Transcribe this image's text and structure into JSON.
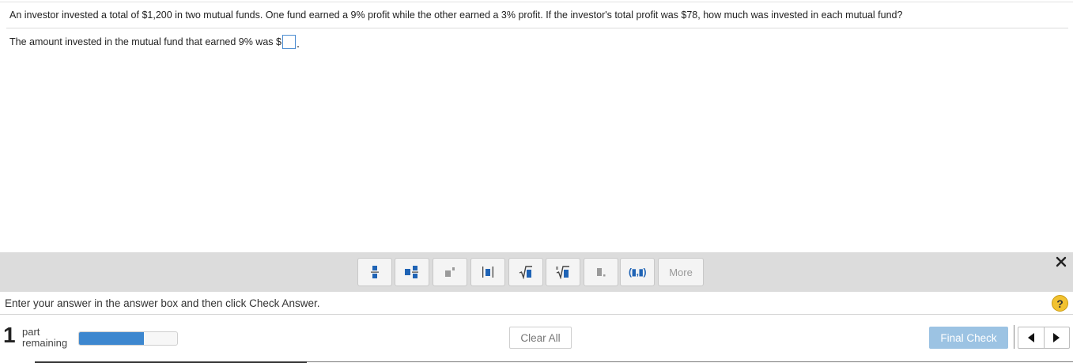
{
  "question": {
    "text": "An investor invested a total of $1,200 in two mutual funds. One fund earned a 9% profit while the other earned a 3% profit. If the investor's total profit was $78, how much was invested in each mutual fund?",
    "answer_prompt": "The amount invested in the mutual fund that earned 9% was $",
    "answer_value": ""
  },
  "toolbar": {
    "buttons": [
      {
        "icon": "fraction-icon"
      },
      {
        "icon": "mixed-number-icon"
      },
      {
        "icon": "exponent-icon"
      },
      {
        "icon": "absolute-value-icon"
      },
      {
        "icon": "square-root-icon"
      },
      {
        "icon": "nth-root-icon"
      },
      {
        "icon": "decimal-icon"
      },
      {
        "icon": "ordered-pair-icon"
      }
    ],
    "ordered_pair_label": "(▮,▮)",
    "more_label": "More"
  },
  "instructions": {
    "text": "Enter your answer in the answer box and then click Check Answer.",
    "help_label": "?"
  },
  "footer": {
    "parts_count": "1",
    "parts_label_1": "part",
    "parts_label_2": "remaining",
    "progress": 0.66,
    "clear_all_label": "Clear All",
    "final_check_label": "Final Check"
  },
  "colors": {
    "accent": "#3d87cf",
    "final_check_bg": "#9cc3e3",
    "toolbar_bg": "#dcdcdc",
    "help_icon": "#f2c230"
  }
}
